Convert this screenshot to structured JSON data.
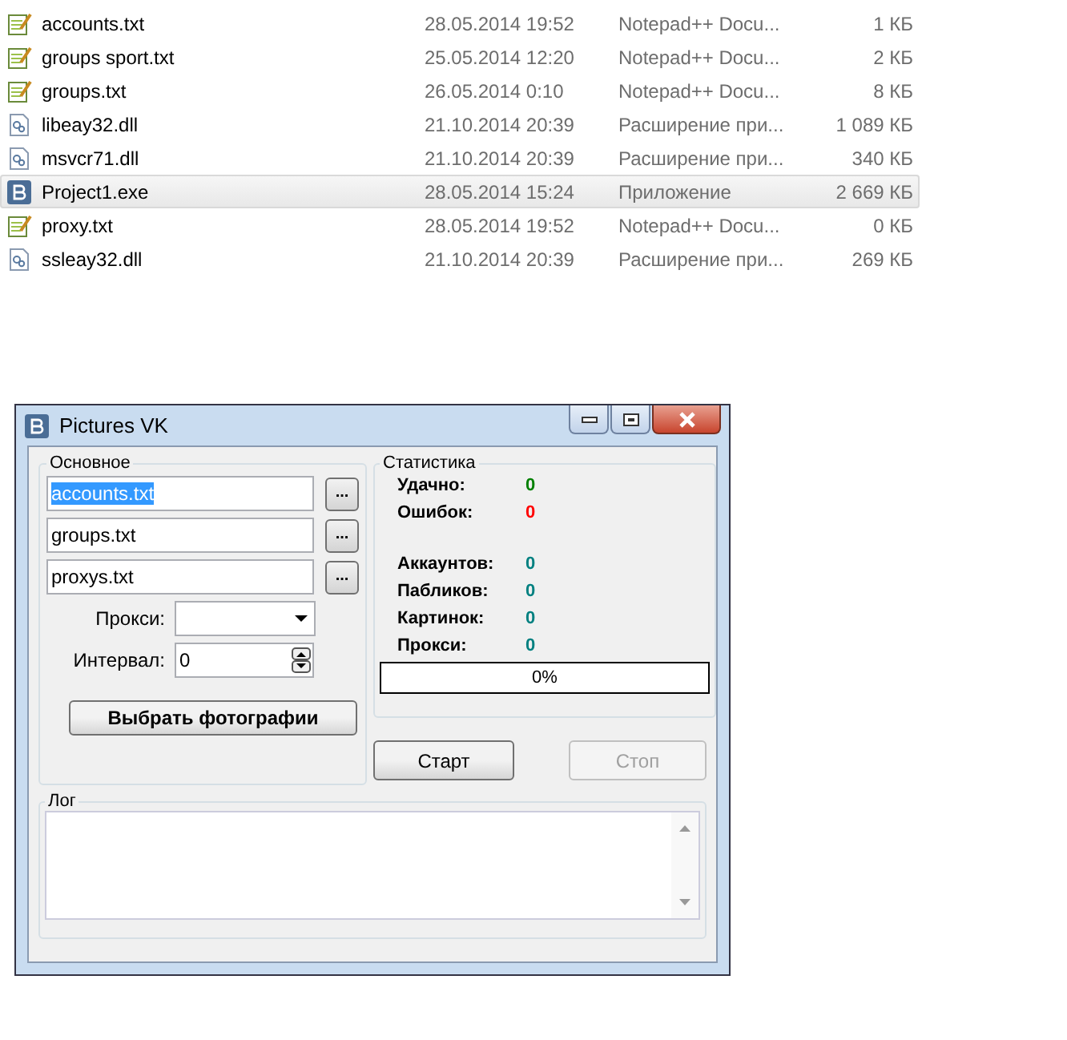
{
  "files": [
    {
      "name": "accounts.txt",
      "kind": "text",
      "date": "28.05.2014 19:52",
      "type": "Notepad++ Docu...",
      "size": "1 КБ",
      "selected": false
    },
    {
      "name": "groups sport.txt",
      "kind": "text",
      "date": "25.05.2014 12:20",
      "type": "Notepad++ Docu...",
      "size": "2 КБ",
      "selected": false
    },
    {
      "name": "groups.txt",
      "kind": "text",
      "date": "26.05.2014 0:10",
      "type": "Notepad++ Docu...",
      "size": "8 КБ",
      "selected": false
    },
    {
      "name": "libeay32.dll",
      "kind": "dll",
      "date": "21.10.2014 20:39",
      "type": "Расширение при...",
      "size": "1 089 КБ",
      "selected": false
    },
    {
      "name": "msvcr71.dll",
      "kind": "dll",
      "date": "21.10.2014 20:39",
      "type": "Расширение при...",
      "size": "340 КБ",
      "selected": false
    },
    {
      "name": "Project1.exe",
      "kind": "exe",
      "date": "28.05.2014 15:24",
      "type": "Приложение",
      "size": "2 669 КБ",
      "selected": true
    },
    {
      "name": "proxy.txt",
      "kind": "text",
      "date": "28.05.2014 19:52",
      "type": "Notepad++ Docu...",
      "size": "0 КБ",
      "selected": false
    },
    {
      "name": "ssleay32.dll",
      "kind": "dll",
      "date": "21.10.2014 20:39",
      "type": "Расширение при...",
      "size": "269 КБ",
      "selected": false
    }
  ],
  "window": {
    "title": "Pictures VK",
    "main": {
      "title": "Основное",
      "fields": [
        {
          "value": "accounts.txt",
          "selected": true,
          "button": "..."
        },
        {
          "value": "groups.txt",
          "selected": false,
          "button": "..."
        },
        {
          "value": "proxys.txt",
          "selected": false,
          "button": "..."
        }
      ],
      "proxy": {
        "label": "Прокси:"
      },
      "interval": {
        "label": "Интервал:",
        "value": "0"
      },
      "select_button": "Выбрать фотографии"
    },
    "stats": {
      "title": "Статистика",
      "results": [
        {
          "label": "Удачно:",
          "value": "0",
          "color": "#008000"
        },
        {
          "label": "Ошибок:",
          "value": "0",
          "color": "#ff0000"
        }
      ],
      "counters": [
        {
          "label": "Аккаунтов:",
          "value": "0",
          "color": "#008080"
        },
        {
          "label": "Пабликов:",
          "value": "0",
          "color": "#008080"
        },
        {
          "label": "Картинок:",
          "value": "0",
          "color": "#008080"
        },
        {
          "label": "Прокси:",
          "value": "0",
          "color": "#008080"
        }
      ],
      "progress": {
        "level": 0,
        "text": "0%"
      }
    },
    "buttons": [
      {
        "label": "Старт",
        "disabled": false
      },
      {
        "label": "Стоп",
        "disabled": true
      }
    ],
    "log": {
      "title": "Лог"
    }
  }
}
